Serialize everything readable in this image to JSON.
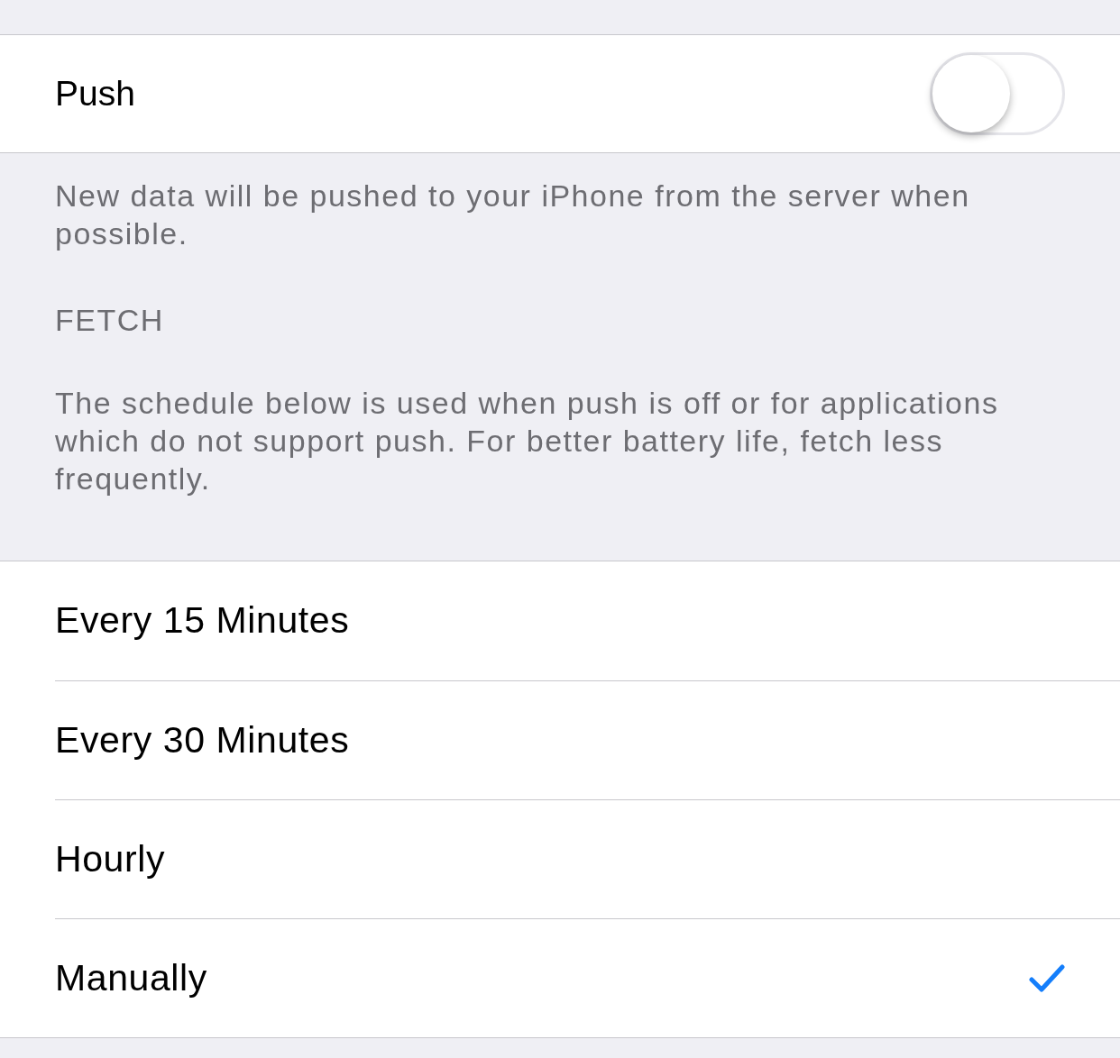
{
  "push": {
    "label": "Push",
    "on": false
  },
  "push_footer": "New data will be pushed to your iPhone from the server when possible.",
  "fetch_header": "FETCH",
  "fetch_footer": "The schedule below is used when push is off or for applications which do not support push. For better battery life, fetch less frequently.",
  "options": [
    {
      "label": "Every 15 Minutes",
      "selected": false
    },
    {
      "label": "Every 30 Minutes",
      "selected": false
    },
    {
      "label": "Hourly",
      "selected": false
    },
    {
      "label": "Manually",
      "selected": true
    }
  ]
}
